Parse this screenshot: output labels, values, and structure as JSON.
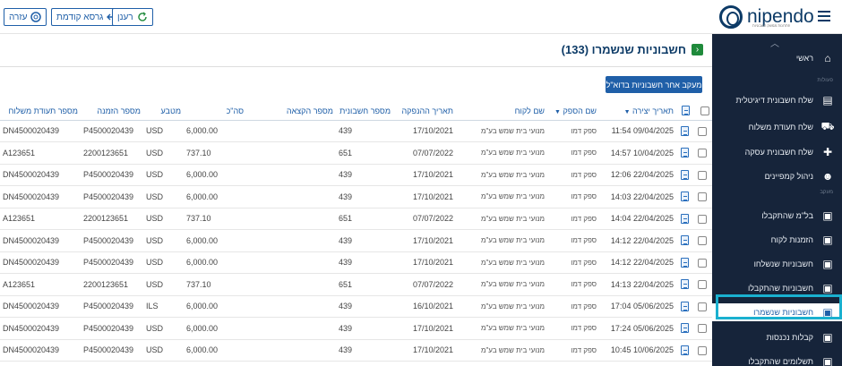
{
  "topbar": {
    "help_label": "עזרה",
    "prev_version_label": "גרסא קודמת",
    "refresh_label": "רענן",
    "logo_text": "nipendo",
    "logo_sub": "פתרונות ממשק חשבוניות"
  },
  "page": {
    "title": "חשבוניות שנשמרו (133)",
    "action_label": "מעקב אחר חשבוניות בדוא\"ל"
  },
  "table": {
    "headers": {
      "created": "תאריך יצירה",
      "supplier": "שם הספק",
      "customer": "שם לקוח",
      "issue_date": "תאריך ההנפקה",
      "invoice_no": "מספר חשבונית",
      "allocation_no": "מספר הקצאה",
      "total": "סה\"כ",
      "currency": "מטבע",
      "order_no": "מספר הזמנה",
      "delivery_no": "מספר תעודת משלוח"
    },
    "rows": [
      {
        "created": "11:54 09/04/2025",
        "supplier": "ספק דמו",
        "customer": "מנועי בית שמש בע\"מ",
        "issue_date": "17/10/2021",
        "invoice_no": "439",
        "allocation_no": "",
        "total": "6,000.00",
        "currency": "USD",
        "order_no": "P4500020439",
        "delivery_no": "DN4500020439"
      },
      {
        "created": "14:57 10/04/2025",
        "supplier": "ספק דמו",
        "customer": "מנועי בית שמש בע\"מ",
        "issue_date": "07/07/2022",
        "invoice_no": "651",
        "allocation_no": "",
        "total": "737.10",
        "currency": "USD",
        "order_no": "2200123651",
        "delivery_no": "A123651"
      },
      {
        "created": "12:06 22/04/2025",
        "supplier": "ספק דמו",
        "customer": "מנועי בית שמש בע\"מ",
        "issue_date": "17/10/2021",
        "invoice_no": "439",
        "allocation_no": "",
        "total": "6,000.00",
        "currency": "USD",
        "order_no": "P4500020439",
        "delivery_no": "DN4500020439"
      },
      {
        "created": "14:03 22/04/2025",
        "supplier": "ספק דמו",
        "customer": "מנועי בית שמש בע\"מ",
        "issue_date": "17/10/2021",
        "invoice_no": "439",
        "allocation_no": "",
        "total": "6,000.00",
        "currency": "USD",
        "order_no": "P4500020439",
        "delivery_no": "DN4500020439"
      },
      {
        "created": "14:04 22/04/2025",
        "supplier": "ספק דמו",
        "customer": "מנועי בית שמש בע\"מ",
        "issue_date": "07/07/2022",
        "invoice_no": "651",
        "allocation_no": "",
        "total": "737.10",
        "currency": "USD",
        "order_no": "2200123651",
        "delivery_no": "A123651"
      },
      {
        "created": "14:12 22/04/2025",
        "supplier": "ספק דמו",
        "customer": "מנועי בית שמש בע\"מ",
        "issue_date": "17/10/2021",
        "invoice_no": "439",
        "allocation_no": "",
        "total": "6,000.00",
        "currency": "USD",
        "order_no": "P4500020439",
        "delivery_no": "DN4500020439"
      },
      {
        "created": "14:12 22/04/2025",
        "supplier": "ספק דמו",
        "customer": "מנועי בית שמש בע\"מ",
        "issue_date": "17/10/2021",
        "invoice_no": "439",
        "allocation_no": "",
        "total": "6,000.00",
        "currency": "USD",
        "order_no": "P4500020439",
        "delivery_no": "DN4500020439"
      },
      {
        "created": "14:13 22/04/2025",
        "supplier": "ספק דמו",
        "customer": "מנועי בית שמש בע\"מ",
        "issue_date": "07/07/2022",
        "invoice_no": "651",
        "allocation_no": "",
        "total": "737.10",
        "currency": "USD",
        "order_no": "2200123651",
        "delivery_no": "A123651"
      },
      {
        "created": "17:04 05/06/2025",
        "supplier": "ספק דמו",
        "customer": "מנועי בית שמש בע\"מ",
        "issue_date": "16/10/2021",
        "invoice_no": "439",
        "allocation_no": "",
        "total": "6,000.00",
        "currency": "ILS",
        "order_no": "P4500020439",
        "delivery_no": "DN4500020439"
      },
      {
        "created": "17:24 05/06/2025",
        "supplier": "ספק דמו",
        "customer": "מנועי בית שמש בע\"מ",
        "issue_date": "17/10/2021",
        "invoice_no": "439",
        "allocation_no": "",
        "total": "6,000.00",
        "currency": "USD",
        "order_no": "P4500020439",
        "delivery_no": "DN4500020439"
      },
      {
        "created": "10:45 10/06/2025",
        "supplier": "ספק דמו",
        "customer": "מנועי בית שמש בע\"מ",
        "issue_date": "17/10/2021",
        "invoice_no": "439",
        "allocation_no": "",
        "total": "6,000.00",
        "currency": "USD",
        "order_no": "P4500020439",
        "delivery_no": "DN4500020439"
      }
    ]
  },
  "sidebar": {
    "home": "ראשי",
    "section_actions": "פעולות",
    "section_monitoring": "מעקב",
    "items": [
      {
        "label": "שלח חשבונית דיגיטלית",
        "icon": "digital-invoice-icon"
      },
      {
        "label": "שלח תעודת משלוח",
        "icon": "delivery-truck-icon"
      },
      {
        "label": "שלח חשבונית עסקה",
        "icon": "pro-invoice-icon"
      },
      {
        "label": "ניהול קמפיינים",
        "icon": "campaign-users-icon"
      },
      {
        "label": "בל\"מ שהתקבלו",
        "icon": "received-docs-icon"
      },
      {
        "label": "הזמנות לקוח",
        "icon": "customer-orders-icon"
      },
      {
        "label": "חשבוניות שנשלחו",
        "icon": "sent-invoices-icon"
      },
      {
        "label": "חשבוניות שהתקבלו",
        "icon": "received-invoices-icon"
      },
      {
        "label": "חשבוניות שנשמרו",
        "icon": "saved-invoices-icon"
      },
      {
        "label": "קבלות נכנסות",
        "icon": "incoming-receipts-icon"
      },
      {
        "label": "תשלומים שהתקבלו",
        "icon": "payments-received-icon"
      }
    ]
  },
  "colors": {
    "accent": "#1f5fa8",
    "sidebar": "#16243a",
    "highlight": "#1ab0cf",
    "title_icon": "#1f8a3b"
  }
}
